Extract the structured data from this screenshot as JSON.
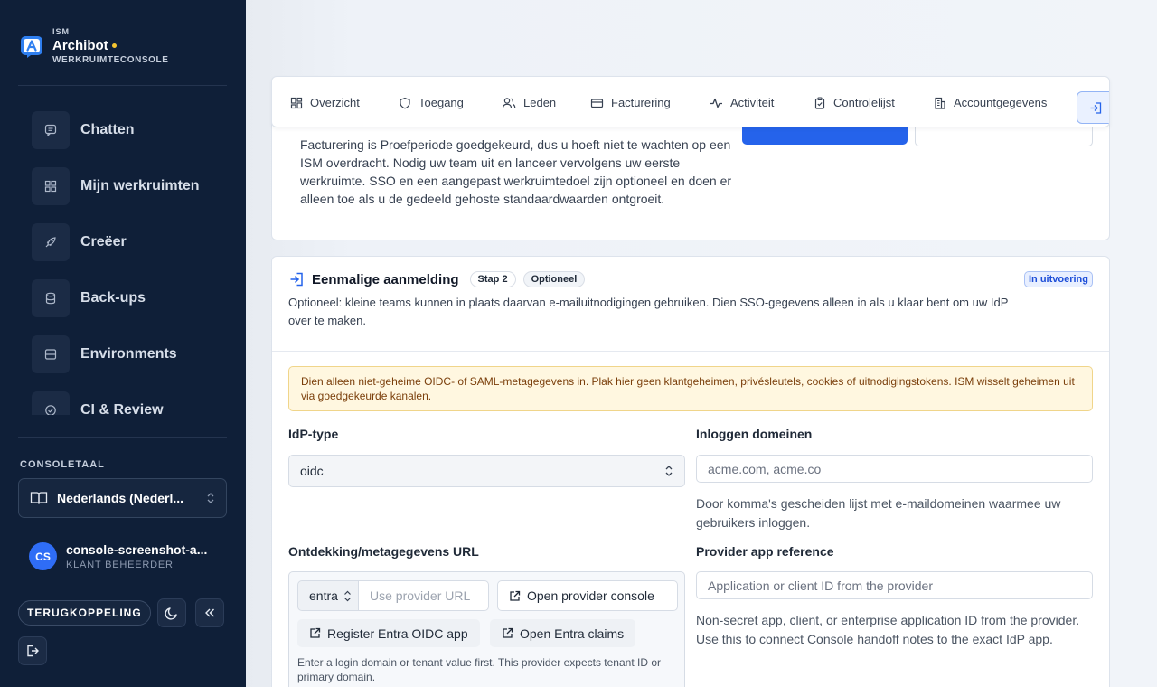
{
  "sidebar": {
    "brand_kicker": "ISM",
    "brand_name": "Archibot",
    "brand_sub": "WERKRUIMTECONSOLE",
    "nav": [
      {
        "label": "Chatten",
        "icon": "chat-icon"
      },
      {
        "label": "Mijn werkruimten",
        "icon": "grid-icon"
      },
      {
        "label": "Creëer",
        "icon": "rocket-icon"
      },
      {
        "label": "Back-ups",
        "icon": "database-icon"
      },
      {
        "label": "Environments",
        "icon": "server-icon"
      },
      {
        "label": "CI & Review",
        "icon": "check-circle-icon"
      }
    ],
    "language_label": "CONSOLETAAL",
    "language_value": "Nederlands (Nederl...",
    "user_initials": "CS",
    "user_name": "console-screenshot-a...",
    "user_role": "KLANT BEHEERDER",
    "feedback_label": "TERUGKOPPELING"
  },
  "tabs": [
    {
      "label": "Overzicht",
      "icon": "layout-icon"
    },
    {
      "label": "Toegang",
      "icon": "shield-icon"
    },
    {
      "label": "Leden",
      "icon": "users-icon"
    },
    {
      "label": "Facturering",
      "icon": "credit-card-icon"
    },
    {
      "label": "Activiteit",
      "icon": "activity-icon"
    },
    {
      "label": "Controlelijst",
      "icon": "clipboard-icon"
    },
    {
      "label": "Accountgegevens",
      "icon": "building-icon"
    }
  ],
  "billing_card": {
    "text": "Facturering is Proefperiode goedgekeurd, dus u hoeft niet te wachten op een ISM overdracht. Nodig uw team uit en lanceer vervolgens uw eerste werkruimte. SSO en een aangepast werkruimtedoel zijn optioneel en doen er alleen toe als u de gedeeld gehoste standaardwaarden ontgroeit."
  },
  "sso": {
    "title": "Eenmalige aanmelding",
    "step": "Stap 2",
    "optional": "Optioneel",
    "status": "In uitvoering",
    "description": "Optioneel: kleine teams kunnen in plaats daarvan e-mailuitnodigingen gebruiken. Dien SSO-gegevens alleen in als u klaar bent om uw IdP over te maken.",
    "warning": "Dien alleen niet-geheime OIDC- of SAML-metagegevens in. Plak hier geen klantgeheimen, privésleutels, cookies of uitnodigingstokens. ISM wisselt geheimen uit via goedgekeurde kanalen.",
    "idp_label": "IdP-type",
    "idp_value": "oidc",
    "domains_label": "Inloggen domeinen",
    "domains_placeholder": "acme.com, acme.co",
    "domains_help": "Door komma's gescheiden lijst met e-maildomeinen waarmee uw gebruikers inloggen.",
    "discovery_label": "Ontdekking/metagegevens URL",
    "provider_value": "entra",
    "url_placeholder": "Use provider URL",
    "open_console": "Open provider console",
    "register_app": "Register Entra OIDC app",
    "open_claims": "Open Entra claims",
    "url_help": "Enter a login domain or tenant value first. This provider expects tenant ID or primary domain.",
    "app_ref_label": "Provider app reference",
    "app_ref_placeholder": "Application or client ID from the provider",
    "app_ref_help": "Non-secret app, client, or enterprise application ID from the provider. Use this to connect Console handoff notes to the exact IdP app."
  }
}
